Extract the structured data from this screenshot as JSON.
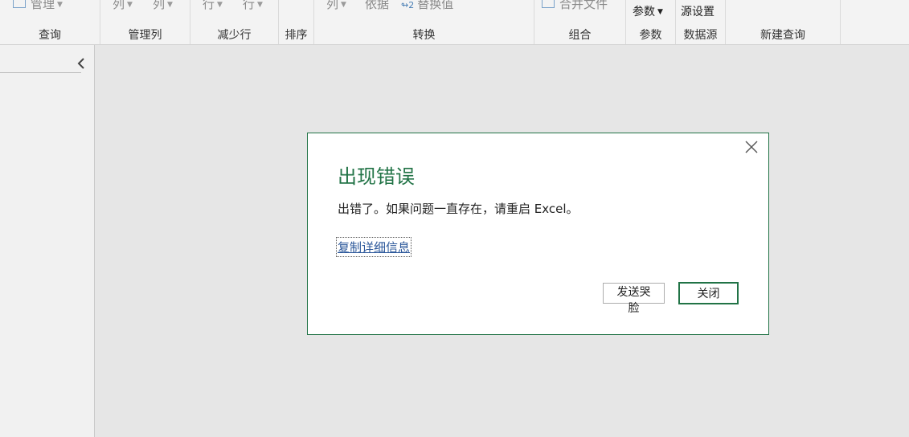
{
  "ribbon": {
    "groups": [
      {
        "title": "查询",
        "cmds": [
          {
            "label": "管理",
            "caret": true,
            "icon": "table-icon"
          }
        ]
      },
      {
        "title": "管理列",
        "cmds": [
          {
            "label": "列",
            "caret": true
          },
          {
            "label": "列",
            "caret": true
          }
        ]
      },
      {
        "title": "减少行",
        "cmds": [
          {
            "label": "行",
            "caret": true
          },
          {
            "label": "行",
            "caret": true
          }
        ]
      },
      {
        "title": "排序",
        "cmds": []
      },
      {
        "title": "转换",
        "cmds": [
          {
            "label": "列",
            "caret": true
          },
          {
            "label": "依据"
          },
          {
            "label": "替换值",
            "icon": "replace-values-icon"
          }
        ]
      },
      {
        "title": "组合",
        "cmds": [
          {
            "label": "合并文件",
            "icon": "combine-files-icon"
          }
        ]
      },
      {
        "title": "参数",
        "cmds": [
          {
            "label": "参数",
            "caret": true
          }
        ]
      },
      {
        "title": "数据源",
        "cmds": [
          {
            "label": "源设置"
          }
        ]
      },
      {
        "title": "新建查询",
        "cmds": []
      }
    ]
  },
  "dialog": {
    "title": "出现错误",
    "message": "出错了。如果问题一直存在，请重启 Excel。",
    "copy_link": "复制详细信息",
    "send_button": "发送哭脸",
    "close_button": "关闭"
  },
  "colors": {
    "accent": "#217346",
    "link": "#2b579a",
    "background": "#e6e6e6"
  }
}
